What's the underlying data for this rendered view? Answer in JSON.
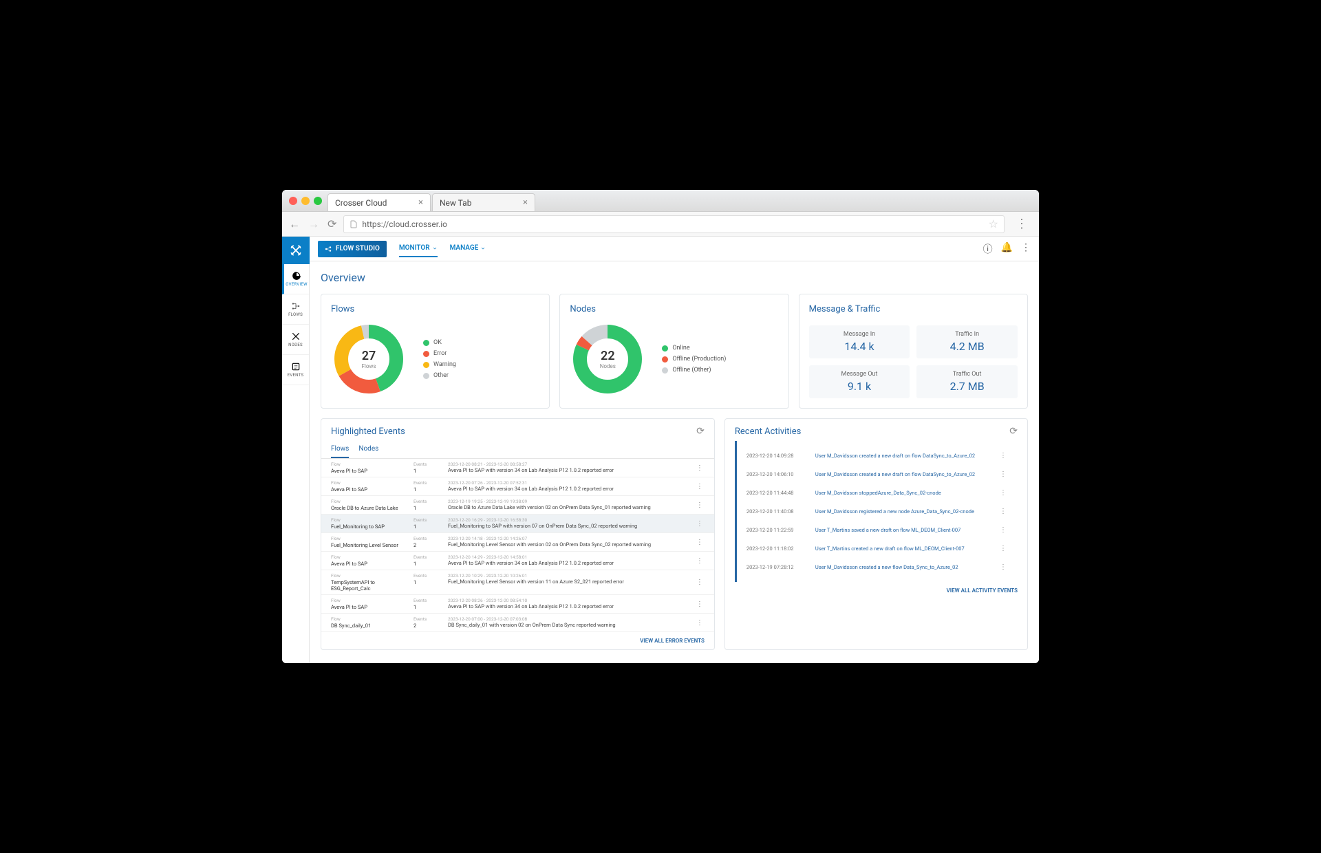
{
  "browser": {
    "tabs": [
      {
        "label": "Crosser Cloud",
        "active": true
      },
      {
        "label": "New Tab",
        "active": false
      }
    ],
    "url": "https://cloud.crosser.io"
  },
  "sidebar": {
    "items": [
      {
        "label": "OVERVIEW",
        "icon": "gauge-icon",
        "active": true
      },
      {
        "label": "FLOWS",
        "icon": "flow-icon",
        "active": false
      },
      {
        "label": "NODES",
        "icon": "nodes-icon",
        "active": false
      },
      {
        "label": "EVENTS",
        "icon": "events-icon",
        "active": false
      }
    ]
  },
  "topbar": {
    "flow_studio": "FLOW STUDIO",
    "nav": [
      {
        "label": "MONITOR",
        "active": true
      },
      {
        "label": "MANAGE",
        "active": false
      }
    ]
  },
  "page_title": "Overview",
  "flows_card": {
    "title": "Flows",
    "count": "27",
    "count_label": "Flows",
    "legend": [
      {
        "label": "OK",
        "color": "#30c46b"
      },
      {
        "label": "Error",
        "color": "#f15b3e"
      },
      {
        "label": "Warning",
        "color": "#f9b814"
      },
      {
        "label": "Other",
        "color": "#cfd3d6"
      }
    ]
  },
  "nodes_card": {
    "title": "Nodes",
    "count": "22",
    "count_label": "Nodes",
    "legend": [
      {
        "label": "Online",
        "color": "#30c46b"
      },
      {
        "label": "Offline (Production)",
        "color": "#f15b3e"
      },
      {
        "label": "Offline (Other)",
        "color": "#cfd3d6"
      }
    ]
  },
  "metrics_card": {
    "title": "Message & Traffic",
    "metrics": [
      {
        "label": "Message In",
        "value": "14.4 k"
      },
      {
        "label": "Traffic In",
        "value": "4.2 MB"
      },
      {
        "label": "Message Out",
        "value": "9.1 k"
      },
      {
        "label": "Traffic Out",
        "value": "2.7 MB"
      }
    ]
  },
  "events_panel": {
    "title": "Highlighted Events",
    "tabs": [
      "Flows",
      "Nodes"
    ],
    "col_flow": "Flow",
    "col_events": "Events",
    "rows": [
      {
        "flow": "Aveva PI to SAP",
        "events": "1",
        "time": "2023-12-20 08:21 - 2023-12-20 08:58:27",
        "desc": "Aveva PI to SAP with version 34 on Lab Analysis P12 1.0.2 reported error",
        "selected": false
      },
      {
        "flow": "Aveva PI to SAP",
        "events": "1",
        "time": "2023-12-20 07:26 - 2023-12-20 07:52:31",
        "desc": "Aveva PI to SAP with version 34 on Lab Analysis P12 1.0.2 reported error",
        "selected": false
      },
      {
        "flow": "Oracle DB to Azure Data Lake",
        "events": "1",
        "time": "2023-12-19 19:25 - 2023-12-19 19:38:09",
        "desc": "Oracle DB to Azure Data Lake with version 02 on OnPrem Data Sync_01 reported warning",
        "selected": false
      },
      {
        "flow": "Fuel_Monitoring to SAP",
        "events": "1",
        "time": "2023-12-20 16:29 - 2023-12-20 16:58:30",
        "desc": "Fuel_Monitoring to SAP with version 07 on OnPrem Data Sync_02 reported warning",
        "selected": true
      },
      {
        "flow": "Fuel_Monitoring Level Sensor",
        "events": "2",
        "time": "2023-12-20 14:18 - 2023-12-20 14:26:07",
        "desc": "Fuel_Monitoring Level Sensor with version 02 on OnPrem Data Sync_02 reported warning",
        "selected": false
      },
      {
        "flow": "Aveva PI to SAP",
        "events": "1",
        "time": "2023-12-20 14:29 - 2023-12-20 14:58:01",
        "desc": "Aveva PI to SAP with version 34 on Lab Analysis P12 1.0.2 reported error",
        "selected": false
      },
      {
        "flow": "TempSystemAPI to ESG_Report_Calc",
        "events": "1",
        "time": "2023-12-20 10:29 - 2023-12-20 10:26:01",
        "desc": "Fuel_Monitoring Level Sensor with version 11 on Azure S2_021 reported error",
        "selected": false
      },
      {
        "flow": "Aveva PI to SAP",
        "events": "1",
        "time": "2023-12-20 08:26 - 2023-12-20 08:54:10",
        "desc": "Aveva PI to SAP with version 34 on Lab Analysis P12 1.0.2 reported error",
        "selected": false
      },
      {
        "flow": "DB Sync_daily_01",
        "events": "2",
        "time": "2023-12-20 07:00 - 2023-12-20 07:03:08",
        "desc": "DB Sync_daily_01 with version 02 on OnPrem Data Sync reported warning",
        "selected": false
      }
    ],
    "footer": "VIEW ALL ERROR EVENTS"
  },
  "activities_panel": {
    "title": "Recent Activities",
    "rows": [
      {
        "time": "2023-12-20 14:09:28",
        "desc": "User M_Davidsson created a new draft on flow DataSync_to_Azure_02"
      },
      {
        "time": "2023-12-20 14:06:10",
        "desc": "User M_Davidsson created a new draft on flow DataSync_to_Azure_02"
      },
      {
        "time": "2023-12-20 11:44:48",
        "desc": "User M_Davidsson stoppedAzure_Data_Sync_02-cnode"
      },
      {
        "time": "2023-12-20 11:40:08",
        "desc": "User M_Davidsson registered a new node Azure_Data_Sync_02-cnode"
      },
      {
        "time": "2023-12-20 11:22:59",
        "desc": "User T_Martins saved a new draft on flow ML_DEOM_Client-007"
      },
      {
        "time": "2023-12-20 11:18:02",
        "desc": "User T_Martins created a new draft on flow ML_DEOM_Client-007"
      },
      {
        "time": "2023-12-19 07:28:12",
        "desc": "User M_Davidsson created a new flow Data_Sync_to_Azure_02"
      }
    ],
    "footer": "VIEW ALL ACTIVITY EVENTS"
  },
  "chart_data": [
    {
      "type": "pie",
      "title": "Flows",
      "total": 27,
      "series": [
        {
          "name": "OK",
          "value": 12,
          "color": "#30c46b"
        },
        {
          "name": "Error",
          "value": 6,
          "color": "#f15b3e"
        },
        {
          "name": "Warning",
          "value": 8,
          "color": "#f9b814"
        },
        {
          "name": "Other",
          "value": 1,
          "color": "#cfd3d6"
        }
      ]
    },
    {
      "type": "pie",
      "title": "Nodes",
      "total": 22,
      "series": [
        {
          "name": "Online",
          "value": 18,
          "color": "#30c46b"
        },
        {
          "name": "Offline (Production)",
          "value": 1,
          "color": "#f15b3e"
        },
        {
          "name": "Offline (Other)",
          "value": 3,
          "color": "#cfd3d6"
        }
      ]
    }
  ]
}
